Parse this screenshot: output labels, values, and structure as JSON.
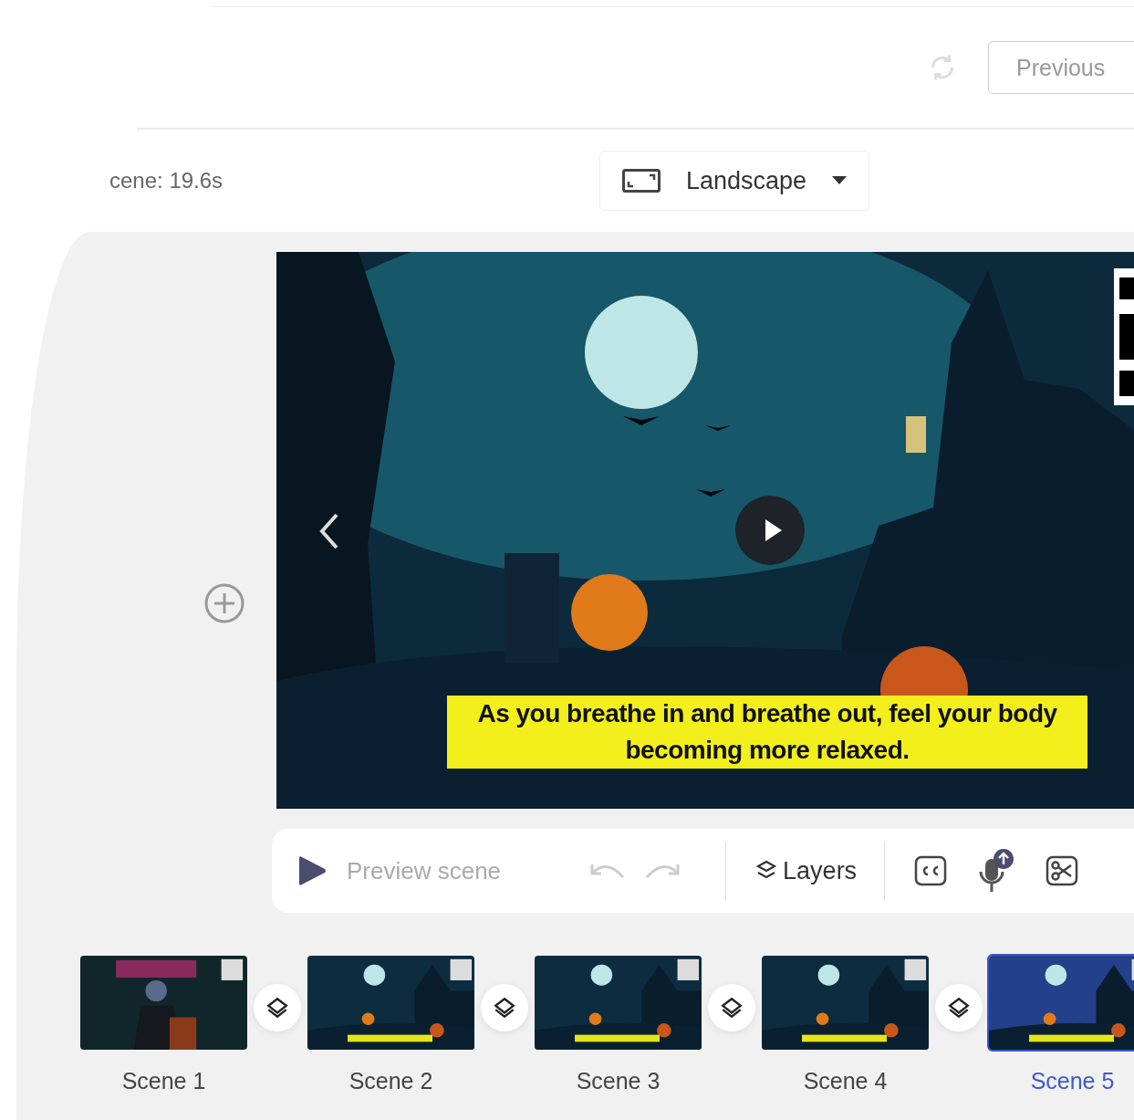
{
  "header": {
    "previous_button": "Previous"
  },
  "scene_duration": "cene: 19.6s",
  "orientation": {
    "label": "Landscape"
  },
  "preview": {
    "caption": "As you breathe in and breathe out, feel your body becoming more relaxed."
  },
  "toolbar": {
    "preview_label": "Preview scene",
    "layers_label": "Layers"
  },
  "scenes": [
    {
      "label": "Scene 1",
      "selected": false,
      "kind": "portrait"
    },
    {
      "label": "Scene 2",
      "selected": false,
      "kind": "night"
    },
    {
      "label": "Scene 3",
      "selected": false,
      "kind": "night"
    },
    {
      "label": "Scene 4",
      "selected": false,
      "kind": "night"
    },
    {
      "label": "Scene 5",
      "selected": true,
      "kind": "night"
    }
  ]
}
